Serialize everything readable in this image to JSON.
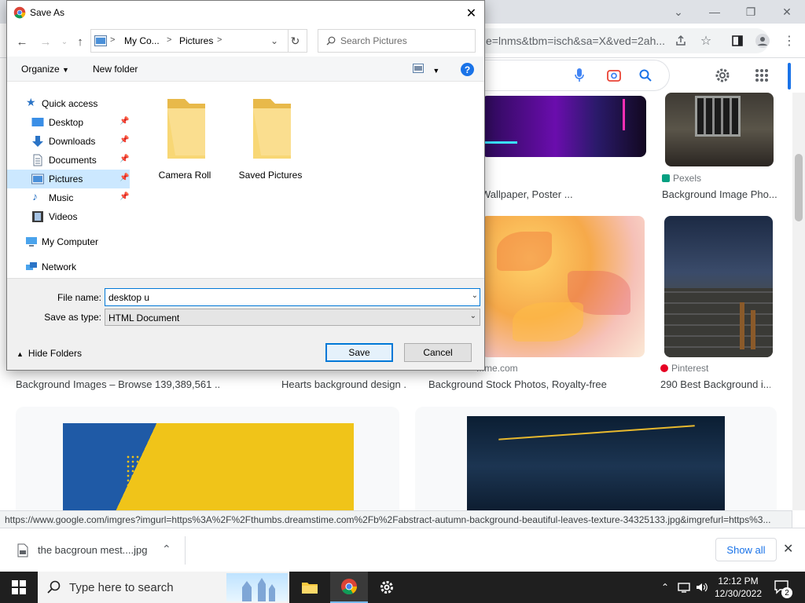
{
  "browser": {
    "url_fragment": "e=lnms&tbm=isch&sa=X&ved=2ah...",
    "status_url": "https://www.google.com/imgres?imgurl=https%3A%2F%2Fthumbs.dreamstime.com%2Fb%2Fabstract-autumn-background-beautiful-leaves-texture-34325133.jpg&imgrefurl=https%3...",
    "results": {
      "row1_right": {
        "source": "Pexels",
        "caption": "Background Image Pho..."
      },
      "row1_mid_caption": "Wallpaper, Poster ...",
      "row2_source_pinterest": "Pinterest",
      "row2_source_domain": "...me.com",
      "captions": [
        "Background Images – Browse 139,389,561 ...",
        "Hearts background design ...",
        "Background Stock Photos, Royalty-free ...",
        "290 Best Background i..."
      ]
    },
    "download": {
      "filename": "the bacgroun mest....jpg",
      "show_all": "Show all"
    }
  },
  "dialog": {
    "title": "Save As",
    "breadcrumb": [
      "My Co...",
      "Pictures"
    ],
    "search_placeholder": "Search Pictures",
    "toolbar": {
      "organize": "Organize",
      "new_folder": "New folder",
      "help": "?"
    },
    "nav": {
      "quick_access": "Quick access",
      "items": [
        "Desktop",
        "Downloads",
        "Documents",
        "Pictures",
        "Music",
        "Videos"
      ],
      "my_computer": "My Computer",
      "network": "Network"
    },
    "folders": [
      "Camera Roll",
      "Saved Pictures"
    ],
    "file_name_label": "File name:",
    "file_name_value": "desktop u",
    "save_type_label": "Save as type:",
    "save_type_value": "HTML Document",
    "hide_folders": "Hide Folders",
    "save": "Save",
    "cancel": "Cancel"
  },
  "taskbar": {
    "search_placeholder": "Type here to search",
    "time": "12:12 PM",
    "date": "12/30/2022",
    "notification_count": "2"
  },
  "colors": {
    "accent": "#0078d7",
    "chrome_blue": "#1a73e8",
    "folder": "#f8d775"
  }
}
